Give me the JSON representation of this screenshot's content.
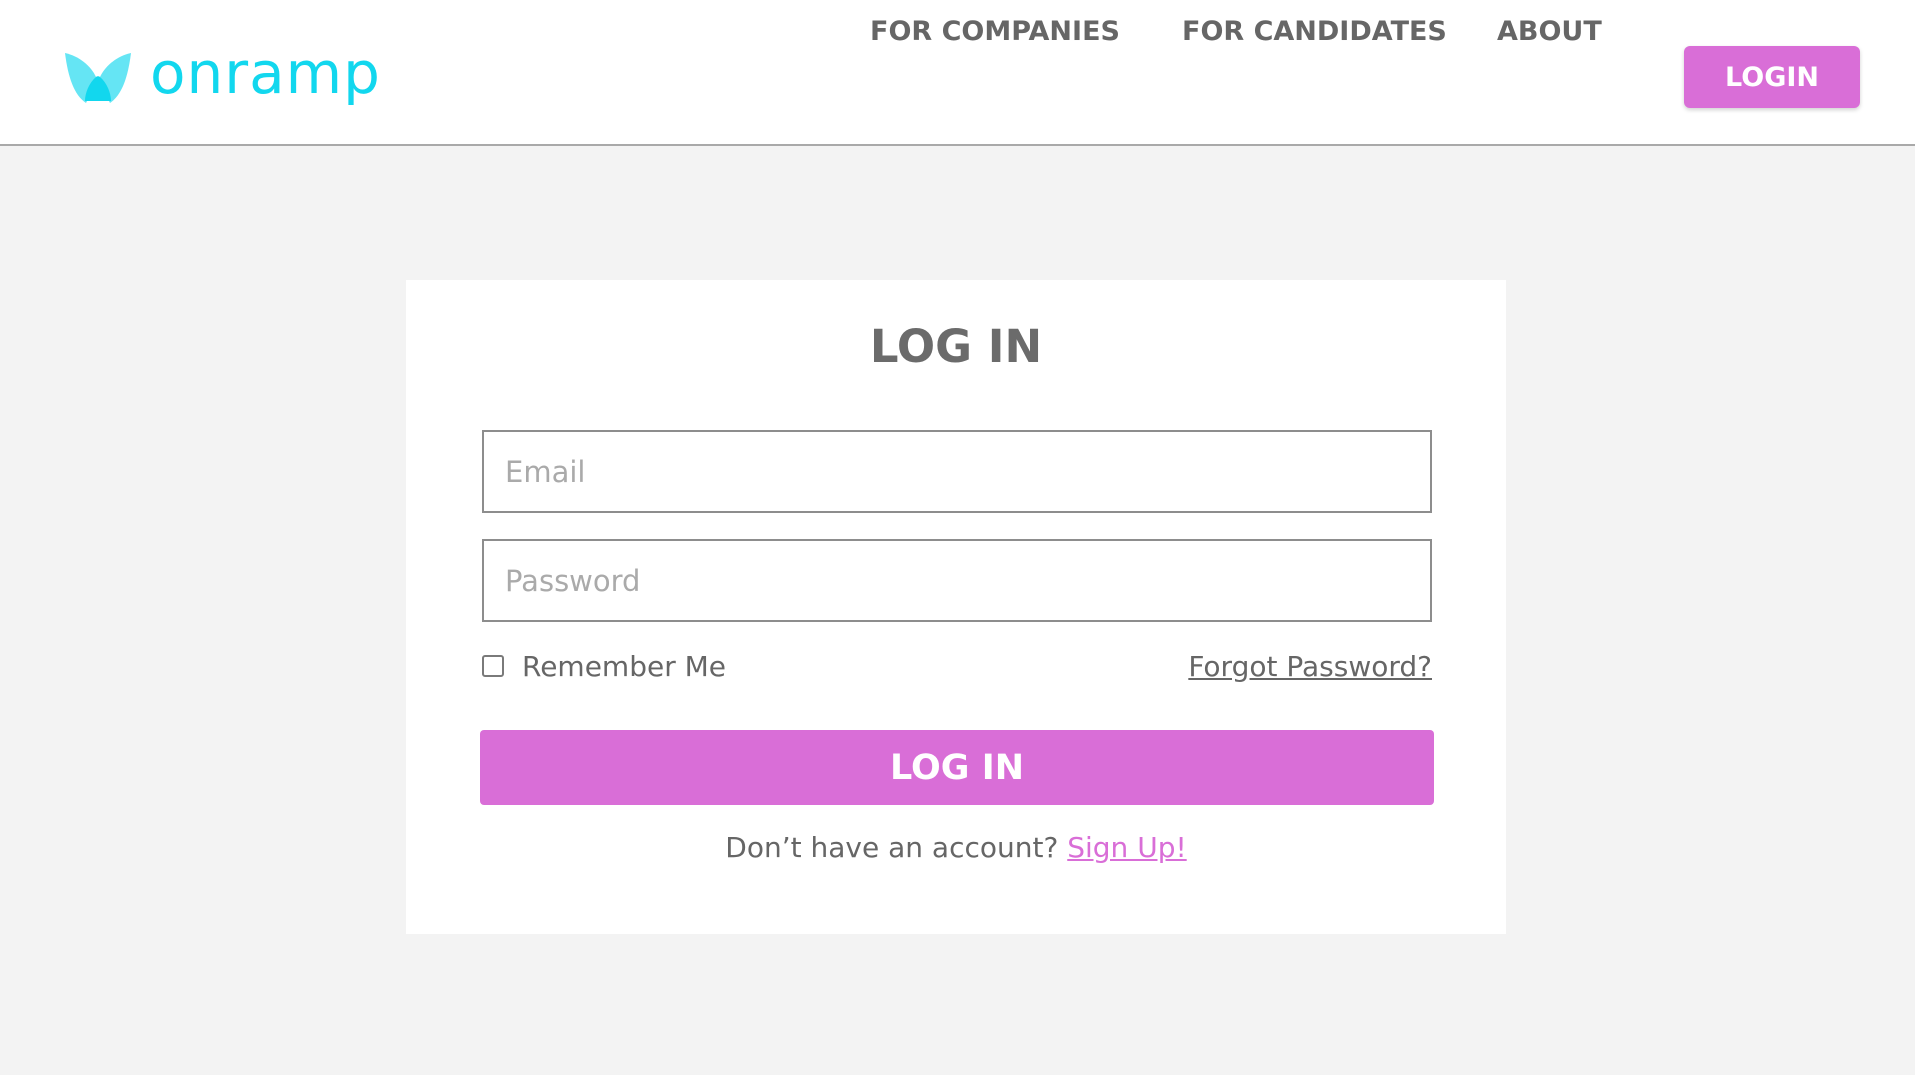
{
  "brand": {
    "name": "onramp",
    "logo_icon": "butterfly-wings-icon",
    "color": "#12d7ee"
  },
  "nav": {
    "items": [
      {
        "label": "FOR COMPANIES"
      },
      {
        "label": "FOR CANDIDATES"
      },
      {
        "label": "ABOUT"
      }
    ],
    "login_label": "LOGIN"
  },
  "login_form": {
    "title": "LOG IN",
    "email": {
      "value": "",
      "placeholder": "Email"
    },
    "password": {
      "value": "",
      "placeholder": "Password"
    },
    "remember_me": {
      "label": "Remember Me",
      "checked": false
    },
    "forgot_password_label": "Forgot Password?",
    "submit_label": "LOG IN",
    "signup_prompt": "Don’t have an account?",
    "signup_link_label": "Sign Up!"
  },
  "colors": {
    "accent": "#d96ed7",
    "brand": "#12d7ee",
    "page_background": "#f3f3f3",
    "text": "#666666"
  }
}
